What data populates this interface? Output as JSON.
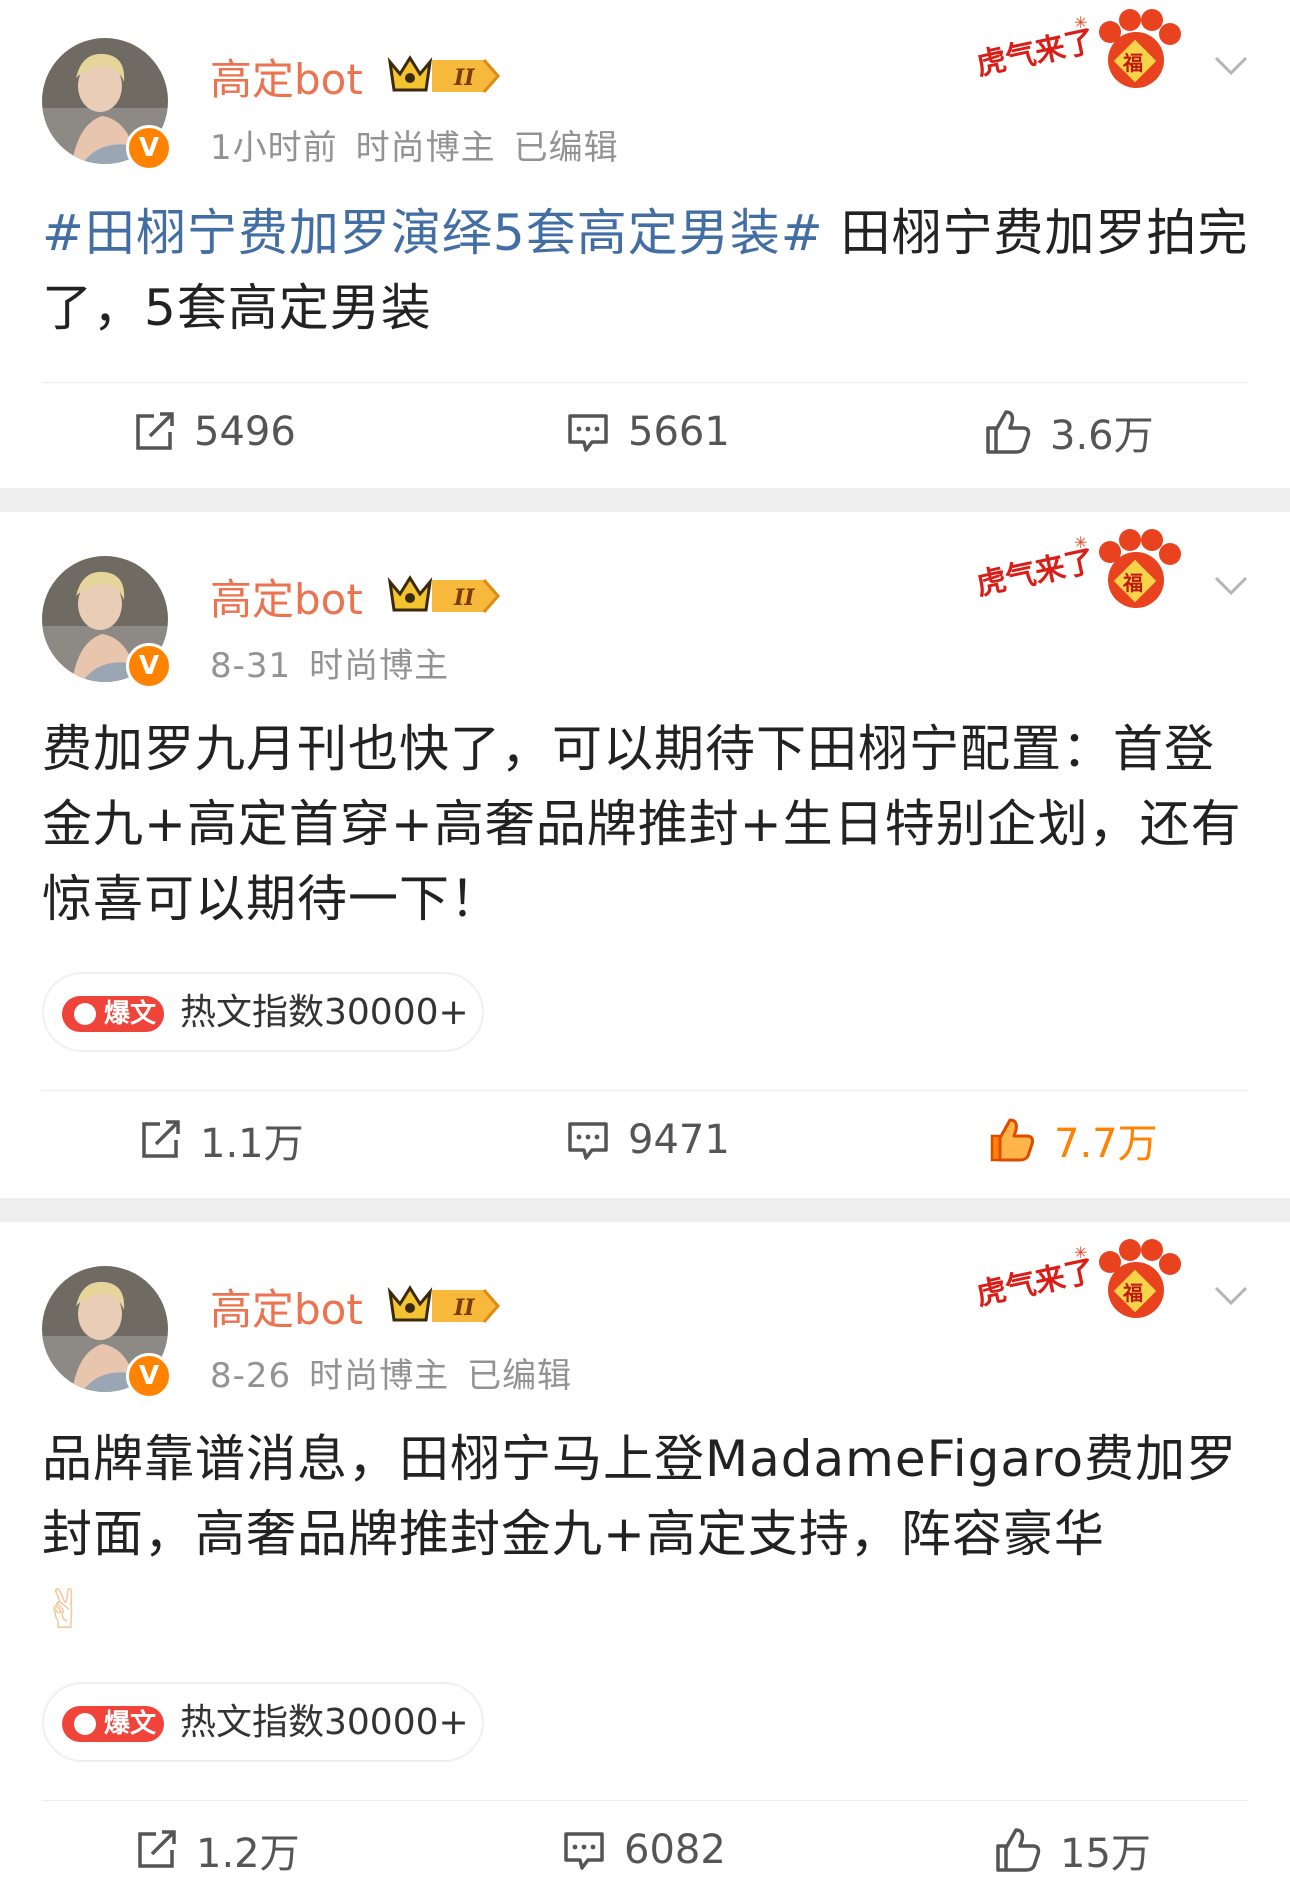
{
  "posts": [
    {
      "username": "高定bot",
      "rank_badge": "II",
      "meta": [
        "1小时前",
        "时尚博主",
        "已编辑"
      ],
      "content_topic": "#田栩宁费加罗演绎5套高定男装#",
      "content_text": " 田栩宁费加罗拍完了，5套高定男装",
      "hot_label": "",
      "hot_text": "",
      "repost_count": "5496",
      "comment_count": "5661",
      "like_count": "3.6万",
      "liked": false
    },
    {
      "username": "高定bot",
      "rank_badge": "II",
      "meta": [
        "8-31",
        "时尚博主"
      ],
      "content_topic": "",
      "content_text": "费加罗九月刊也快了，可以期待下田栩宁配置：首登金九+高定首穿+高奢品牌推封+生日特别企划，还有惊喜可以期待一下！",
      "hot_label": "爆文",
      "hot_text": "热文指数30000+",
      "repost_count": "1.1万",
      "comment_count": "9471",
      "like_count": "7.7万",
      "liked": true
    },
    {
      "username": "高定bot",
      "rank_badge": "II",
      "meta": [
        "8-26",
        "时尚博主",
        "已编辑"
      ],
      "content_topic": "",
      "content_text": "品牌靠谱消息，田栩宁马上登MadameFigaro费加罗封面，高奢品牌推封金九+高定支持，阵容豪华",
      "content_emoji": "✌",
      "hot_label": "爆文",
      "hot_text": "热文指数30000+",
      "repost_count": "1.2万",
      "comment_count": "6082",
      "like_count": "15万",
      "liked": false
    }
  ],
  "deco_text": "虎气来了",
  "deco_icon": "fu-paw-icon",
  "colors": {
    "username": "#eb7350",
    "topic": "#436ea4",
    "liked": "#ff8200",
    "hot_pill": "#f0443a",
    "verified": "#ff8200"
  }
}
